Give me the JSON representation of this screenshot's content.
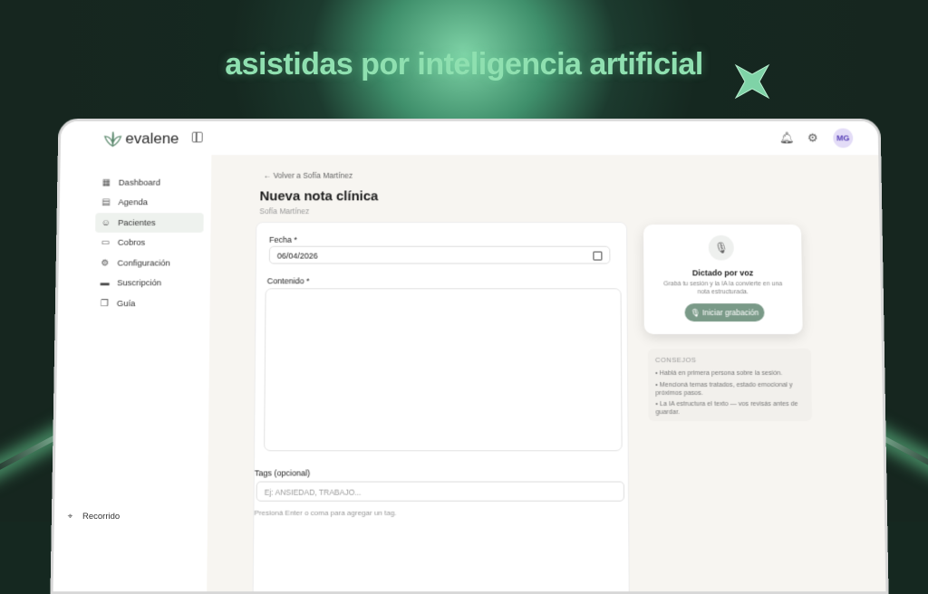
{
  "headline": "asistidas por inteligencia artificial",
  "app": {
    "brand": "evalene",
    "avatar_initials": "MG"
  },
  "sidebar": {
    "items": [
      {
        "label": "Dashboard",
        "icon": "grid-icon"
      },
      {
        "label": "Agenda",
        "icon": "calendar-icon"
      },
      {
        "label": "Pacientes",
        "icon": "users-icon",
        "active": true
      },
      {
        "label": "Cobros",
        "icon": "wallet-icon"
      },
      {
        "label": "Configuración",
        "icon": "gear-icon"
      },
      {
        "label": "Suscripción",
        "icon": "card-icon"
      },
      {
        "label": "Guía",
        "icon": "book-icon"
      }
    ],
    "footer": "Recorrido"
  },
  "main": {
    "back_link": "Volver a Sofía Martínez",
    "title": "Nueva nota clínica",
    "subtitle": "Sofía Martínez",
    "form": {
      "date_label": "Fecha *",
      "date_value": "06/04/2026",
      "content_label": "Contenido *",
      "content_value": "",
      "tags_label": "Tags (opcional)",
      "tags_placeholder": "Ej: ANSIEDAD, TRABAJO...",
      "tags_hint": "Presioná Enter o coma para agregar un tag."
    },
    "dictation": {
      "title": "Dictado por voz",
      "description": "Grabá tu sesión y la IA la convierte en una nota estructurada.",
      "button": "Iniciar grabación"
    },
    "tips": {
      "heading": "CONSEJOS",
      "items": [
        "• Hablá en primera persona sobre la sesión.",
        "• Mencioná temas tratados, estado emocional y próximos pasos.",
        "• La IA estructura el texto — vos revisás antes de guardar."
      ]
    }
  },
  "colors": {
    "accent": "#7a9a88",
    "headline": "#8fe0b0",
    "background": "#152820"
  }
}
